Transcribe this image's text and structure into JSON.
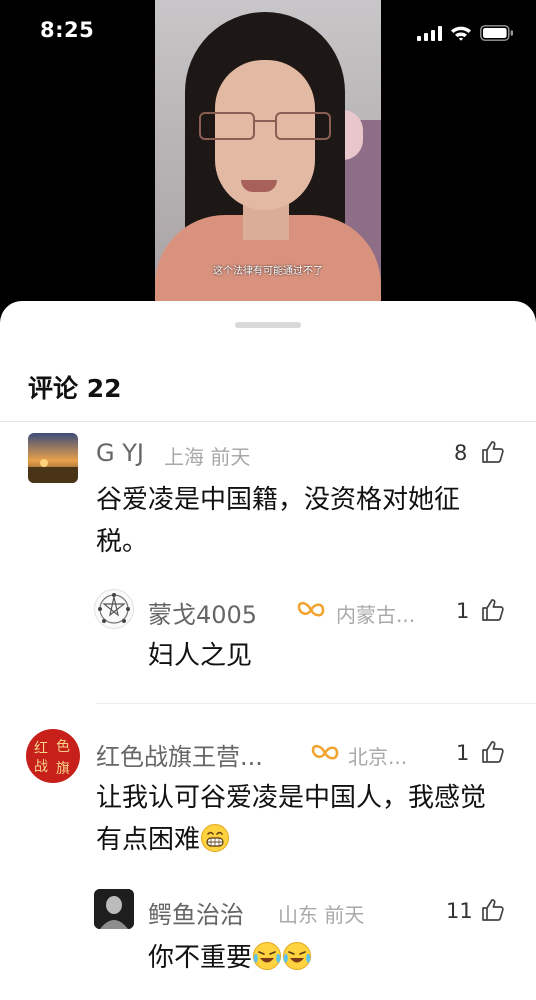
{
  "status_bar": {
    "time": "8:25"
  },
  "video": {
    "caption": "这个法律有可能通过不了"
  },
  "comments_panel": {
    "title": "评论 22"
  },
  "comments": [
    {
      "username": "G YJ",
      "location": "上海",
      "time": "前天",
      "likes": "8",
      "text": "谷爱凌是中国籍，没资格对她征税。",
      "reply": {
        "username": "蒙戈4005",
        "location": "内蒙古...",
        "likes": "1",
        "text": "妇人之见"
      }
    },
    {
      "username": "红色战旗王营...",
      "location": "北京...",
      "likes": "1",
      "text": "让我认可谷爱凌是中国人，我感觉有点困难",
      "reply": {
        "username": "鳄鱼治治",
        "location": "山东",
        "time": "前天",
        "likes": "11",
        "text": "你不重要"
      }
    }
  ],
  "icons": [
    "signal-icon",
    "wifi-icon",
    "battery-icon",
    "like-icon",
    "vip-badge-icon",
    "grinning-emoji",
    "crying-laughing-emoji"
  ],
  "colors": {
    "vip_badge": "#f2a431",
    "meta_text": "#a9a9a9",
    "username_text": "#666666"
  }
}
